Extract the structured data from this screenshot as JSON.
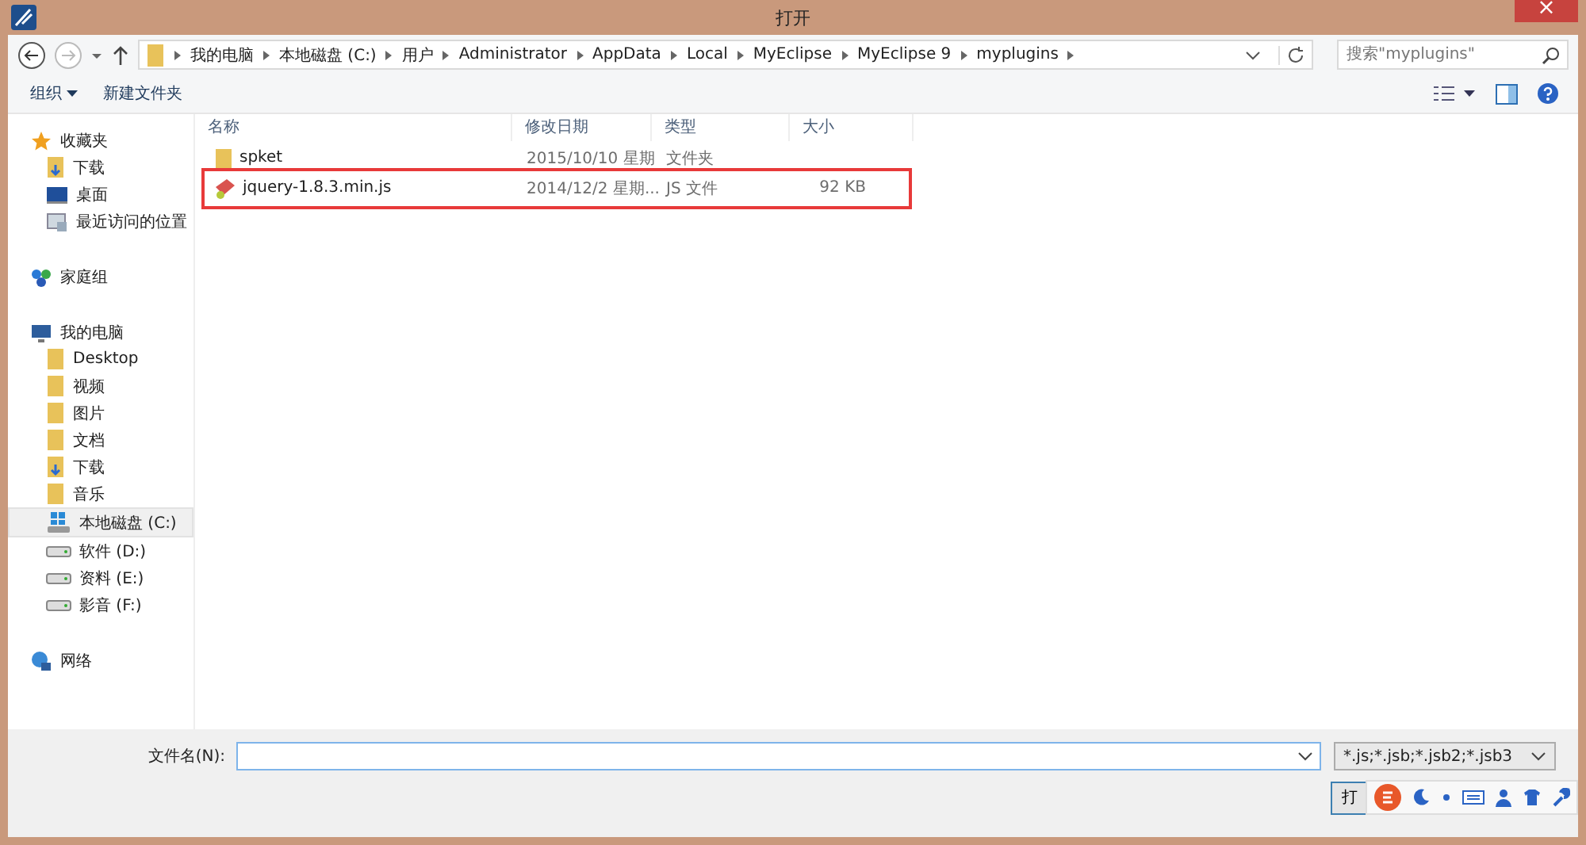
{
  "window": {
    "title": "打开",
    "close": "×"
  },
  "breadcrumb": [
    "我的电脑",
    "本地磁盘 (C:)",
    "用户",
    "Administrator",
    "AppData",
    "Local",
    "MyEclipse",
    "MyEclipse 9",
    "myplugins"
  ],
  "search": {
    "placeholder": "搜索\"myplugins\""
  },
  "toolbar": {
    "organize": "组织",
    "new_folder": "新建文件夹"
  },
  "sidebar": {
    "groups": [
      {
        "label": "收藏夹",
        "kind": "star",
        "children": [
          {
            "label": "下载",
            "kind": "download",
            "selected": false
          },
          {
            "label": "桌面",
            "kind": "desktop",
            "selected": false
          },
          {
            "label": "最近访问的位置",
            "kind": "recent",
            "selected": false
          }
        ]
      },
      {
        "label": "家庭组",
        "kind": "homegroup"
      },
      {
        "label": "我的电脑",
        "kind": "computer",
        "children": [
          {
            "label": "Desktop",
            "kind": "folder",
            "selected": false
          },
          {
            "label": "视频",
            "kind": "folder",
            "selected": false
          },
          {
            "label": "图片",
            "kind": "folder",
            "selected": false
          },
          {
            "label": "文档",
            "kind": "folder",
            "selected": false
          },
          {
            "label": "下载",
            "kind": "download",
            "selected": false
          },
          {
            "label": "音乐",
            "kind": "folder",
            "selected": false
          },
          {
            "label": "本地磁盘 (C:)",
            "kind": "sysdrive",
            "selected": true
          },
          {
            "label": "软件 (D:)",
            "kind": "drive",
            "selected": false
          },
          {
            "label": "资料 (E:)",
            "kind": "drive",
            "selected": false
          },
          {
            "label": "影音 (F:)",
            "kind": "drive",
            "selected": false
          }
        ]
      },
      {
        "label": "网络",
        "kind": "network"
      }
    ]
  },
  "table": {
    "columns": [
      "名称",
      "修改日期",
      "类型",
      "大小"
    ],
    "rows": [
      {
        "kind": "folder",
        "name": "spket",
        "date": "2015/10/10 星期",
        "type": "文件夹",
        "highlighted": false
      },
      {
        "kind": "js",
        "name": "jquery-1.8.3.min.js",
        "date": "2014/12/2 星期...",
        "type": "JS 文件",
        "size": "92 KB",
        "highlighted": true
      }
    ]
  },
  "filename": {
    "label": "文件名(N):"
  },
  "filter": {
    "value": "*.js;*.jsb;*.jsb2;*.jsb3"
  },
  "buttons": [
    "打"
  ]
}
